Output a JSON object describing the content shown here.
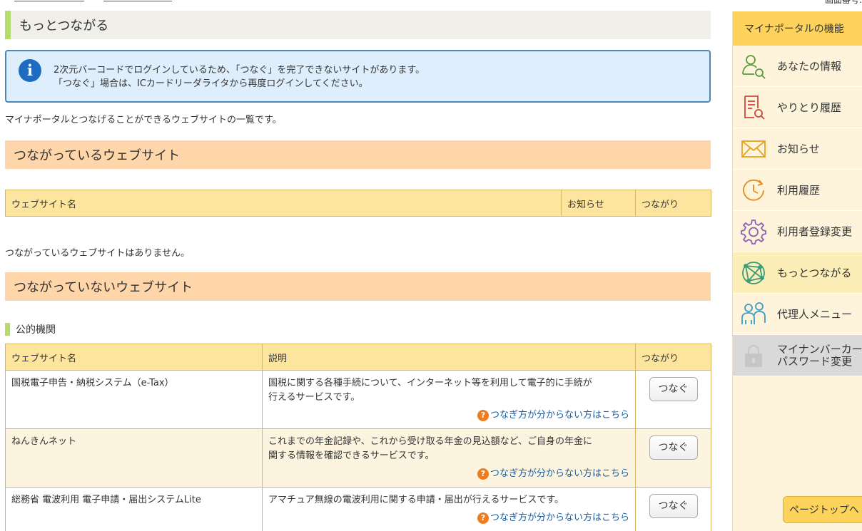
{
  "page_title": "もっとつながる",
  "notice": {
    "line1": "2次元バーコードでログインしているため、「つなぐ」を完了できないサイトがあります。",
    "line2": "「つなぐ」場合は、ICカードリーダライタから再度ログインしてください。"
  },
  "intro": "マイナポータルとつなげることができるウェブサイトの一覧です。",
  "connected": {
    "heading": "つながっているウェブサイト",
    "columns": [
      "ウェブサイト名",
      "お知らせ",
      "つながり"
    ],
    "empty_message": "つながっているウェブサイトはありません。"
  },
  "not_connected": {
    "heading": "つながっていないウェブサイト",
    "subheading": "公的機関",
    "columns": [
      "ウェブサイト名",
      "説明",
      "つながり"
    ],
    "rows": [
      {
        "name": "国税電子申告・納税システム（e-Tax）",
        "desc_line1": "国税に関する各種手続について、インターネット等を利用して電子的に手続が",
        "desc_line2": "行えるサービスです。",
        "help": "つなぎ方が分からない方はこちら",
        "button": "つなぐ"
      },
      {
        "name": "ねんきんネット",
        "desc_line1": "これまでの年金記録や、これから受け取る年金の見込額など、ご自身の年金に",
        "desc_line2": "関する情報を確認できるサービスです。",
        "help": "つなぎ方が分からない方はこちら",
        "button": "つなぐ"
      },
      {
        "name": "総務省 電波利用 電子申請・届出システムLite",
        "desc_line1": "アマチュア無線の電波利用に関する申請・届出が行えるサービスです。",
        "desc_line2": "",
        "help": "つなぎ方が分からない方はこちら",
        "button": "つなぐ"
      }
    ]
  },
  "sidebar": {
    "heading": "マイナポータルの機能",
    "items": [
      {
        "label": "あなたの情報",
        "icon": "person-search-icon"
      },
      {
        "label": "やりとり履歴",
        "icon": "document-search-icon"
      },
      {
        "label": "お知らせ",
        "icon": "envelope-icon"
      },
      {
        "label": "利用履歴",
        "icon": "clock-history-icon"
      },
      {
        "label": "利用者登録変更",
        "icon": "gear-icon"
      },
      {
        "label": "もっとつながる",
        "icon": "globe-network-icon"
      },
      {
        "label": "代理人メニュー",
        "icon": "people-icon"
      },
      {
        "label_line1": "マイナンバーカー",
        "label_line2": "パスワード変更",
        "icon": "lock-icon"
      }
    ]
  },
  "back_to_top": "ページトップへ",
  "top_right_fragment": "画面番号:"
}
